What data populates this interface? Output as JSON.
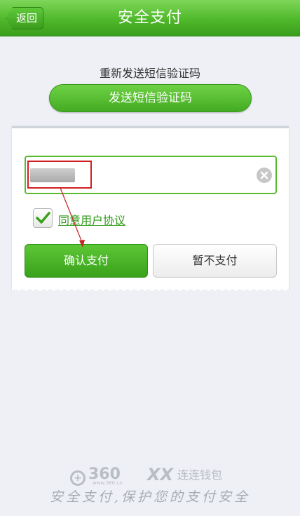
{
  "header": {
    "back_label": "返回",
    "title": "安全支付"
  },
  "verify": {
    "resend_text": "重新发送短信验证码",
    "send_button": "发送短信验证码"
  },
  "form": {
    "code_input_value": "",
    "agree_label": "同意用户协议",
    "agree_checked": true,
    "confirm_button": "确认支付",
    "skip_button": "暂不支付"
  },
  "footer": {
    "logo_360_text": "360",
    "logo_360_url": "www.360.cn",
    "logo_lianlian_mark": "XX",
    "logo_lianlian_text": "连连钱包",
    "slogan": "安全支付,保护您的支付安全"
  },
  "colors": {
    "brand_green": "#4fb82a",
    "link_green": "#2e9a17",
    "annotation_red": "#d12020"
  }
}
